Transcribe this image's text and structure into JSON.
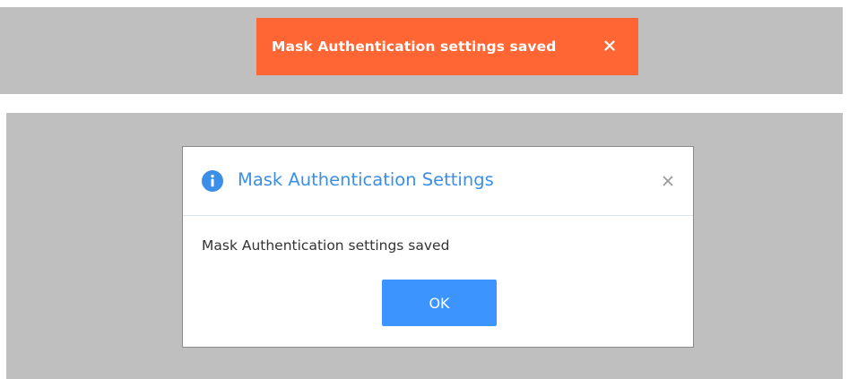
{
  "toast": {
    "message": "Mask Authentication settings saved",
    "close_icon": "close-icon",
    "background_color": "#ff6633",
    "text_color": "#ffffff"
  },
  "dialog": {
    "icon": "info-icon",
    "title": "Mask Authentication Settings",
    "message": "Mask Authentication settings saved",
    "ok_label": "OK",
    "close_icon": "close-icon",
    "title_color": "#3c8fe6",
    "button_color": "#3c95ff"
  },
  "backdrop_color": "#bfbfbf"
}
